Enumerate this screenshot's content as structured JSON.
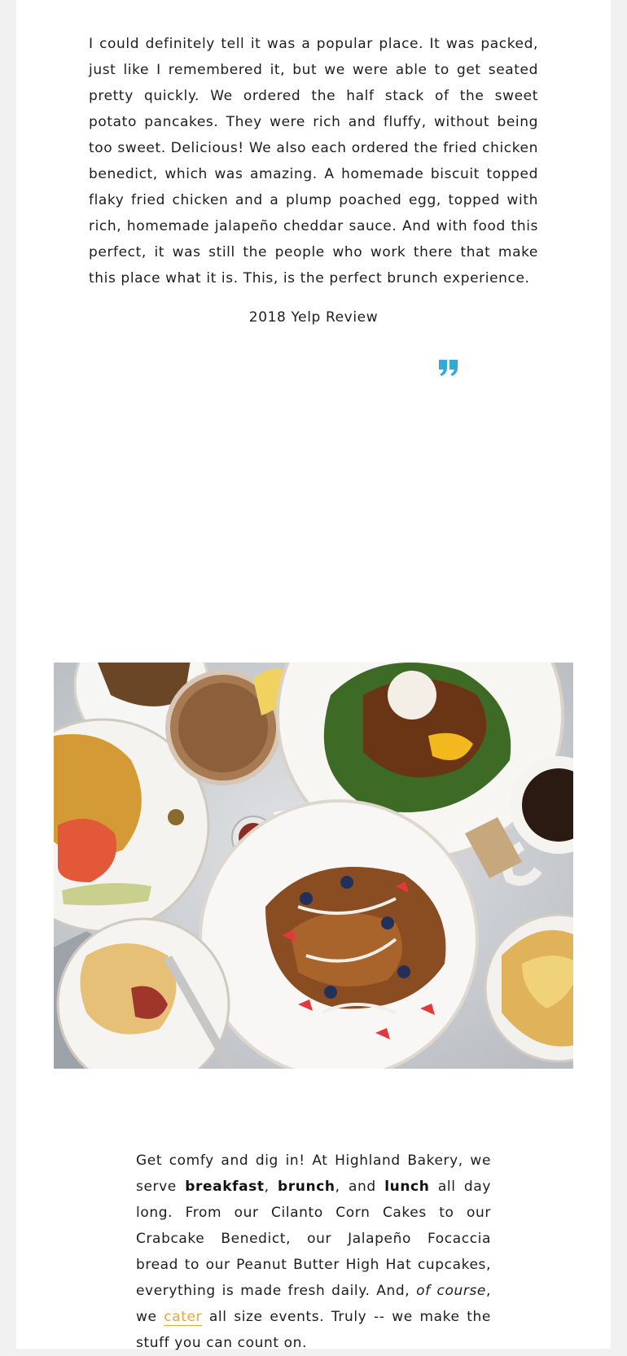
{
  "colors": {
    "accent_blue": "#35a8d8",
    "link_orange": "#e7a53a",
    "page_bg": "#f1f1f1",
    "card_bg": "#ffffff"
  },
  "testimonial": {
    "open_quote_icon": "quote-open-icon",
    "body": "I could definitely tell it was a popular place. It was packed, just like I remembered it, but we were able to get seated pretty quickly. We ordered the half stack of the sweet potato pancakes. They were rich and fluffy, without being too sweet. Delicious! We also each ordered the fried chicken benedict, which was amazing. A homemade biscuit topped flaky fried chicken and a plump poached egg, topped with rich, homemade jalapeño cheddar sauce. And with food this perfect, it was still the people who work there that make this place what it is. This, is the perfect brunch experience.",
    "source": "2018 Yelp Review",
    "close_quote_icon": "quote-close-icon"
  },
  "photo": {
    "subject": "brunch table spread",
    "icon": "food-photo-image"
  },
  "intro": {
    "part1": "Get comfy and dig in! At Highland Bakery, we serve ",
    "breakfast": "breakfast",
    "sep1": ", ",
    "brunch": "brunch",
    "sep2": ", and ",
    "lunch": "lunch",
    "part2": " all day long. From our Cilanto Corn Cakes to our Crabcake Benedict, our Jalapeño Focaccia bread to our Peanut Butter High Hat cupcakes, everything is made fresh daily. And, ",
    "of_course": "of course",
    "part3": ", we ",
    "cater_link": "cater",
    "part4": " all size events. Truly -- we make the stuff you can count on."
  }
}
